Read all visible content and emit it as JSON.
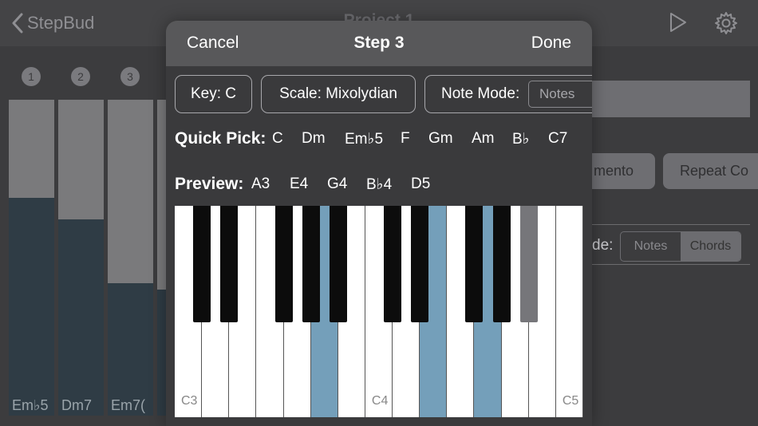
{
  "nav": {
    "back_label": "StepBud",
    "title": "Project 1",
    "play_icon": "play-icon",
    "settings_icon": "gear-icon"
  },
  "steps": [
    {
      "number": "1",
      "label": "Em♭5",
      "level": 0.69
    },
    {
      "number": "2",
      "label": "Dm7",
      "level": 0.62
    },
    {
      "number": "3",
      "label": "Em7(",
      "level": 0.42
    }
  ],
  "background_controls": {
    "portamento_label": "mento",
    "repeat_label": "Repeat Co",
    "mode_label": "de:",
    "mode_options": [
      "Notes",
      "Chords"
    ],
    "mode_selected": "Chords"
  },
  "modal": {
    "cancel_label": "Cancel",
    "title": "Step 3",
    "done_label": "Done",
    "key_label": "Key: C",
    "scale_label": "Scale: Mixolydian",
    "note_mode_label": "Note Mode:",
    "note_mode_value": "Notes",
    "quick_pick_label": "Quick Pick:",
    "quick_picks": [
      "C",
      "Dm",
      "Em♭5",
      "F",
      "Gm",
      "Am",
      "B♭",
      "C7"
    ],
    "preview_label": "Preview:",
    "preview_notes": [
      "A3",
      "E4",
      "G4",
      "B♭4",
      "D5"
    ]
  },
  "piano": {
    "octave_labels": [
      "C3",
      "C4",
      "C5"
    ],
    "white_keys": [
      "C3",
      "D3",
      "E3",
      "F3",
      "G3",
      "A3",
      "B3",
      "C4",
      "D4",
      "E4",
      "F4",
      "G4",
      "A4",
      "B4",
      "C5"
    ],
    "black_keys": [
      "C#3",
      "D#3",
      "F#3",
      "G#3",
      "A#3",
      "C#4",
      "D#4",
      "F#4",
      "G#4",
      "A#4"
    ],
    "highlighted_white": [
      "A3",
      "E4",
      "G4"
    ],
    "highlighted_black": [
      "A#4"
    ],
    "highlight_color": "#749fba",
    "black_highlight_color": "#76767a"
  }
}
